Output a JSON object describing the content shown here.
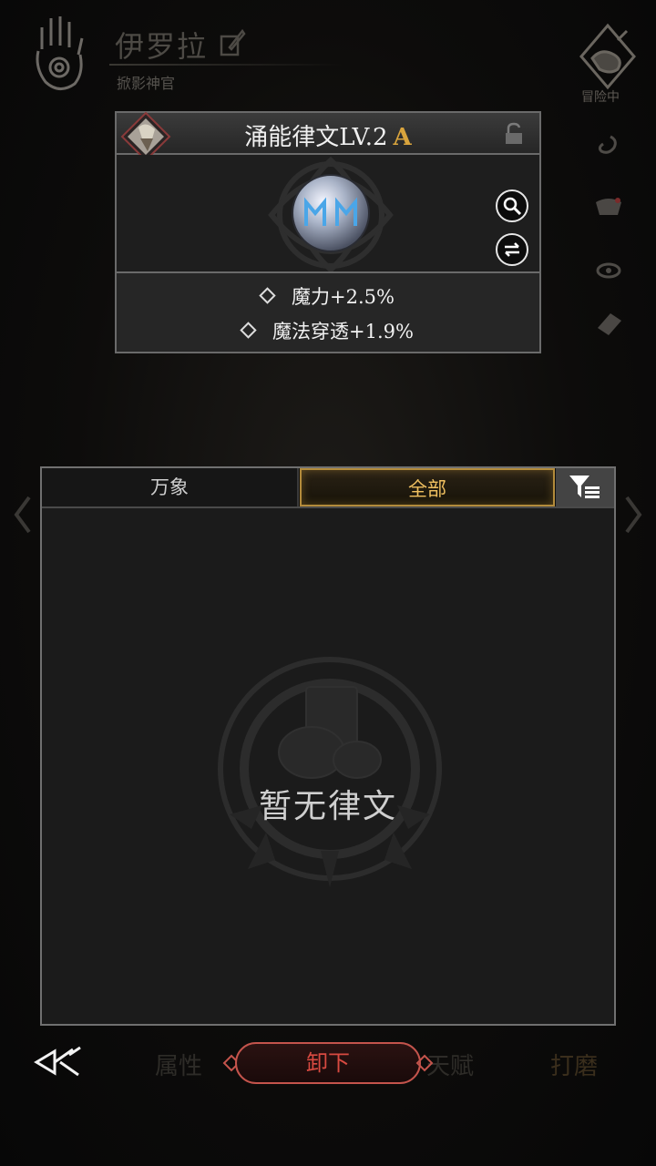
{
  "header": {
    "char_name": "伊罗拉",
    "char_title": "掀影神官",
    "adventure_label": "冒险中"
  },
  "rune_card": {
    "name": "涌能律文LV.2",
    "grade": "A",
    "stats": [
      "魔力+2.5%",
      "魔法穿透+1.9%"
    ]
  },
  "panel": {
    "tabs": [
      "万象",
      "全部"
    ],
    "active_tab": "全部",
    "empty_text": "暂无律文"
  },
  "bottom": {
    "left_tab": "属性",
    "right_tab": "天赋",
    "far_right_tab": "打磨",
    "unequip_label": "卸下"
  },
  "colors": {
    "accent_gold": "#d9a43d",
    "unequip_red": "#d84a41"
  }
}
